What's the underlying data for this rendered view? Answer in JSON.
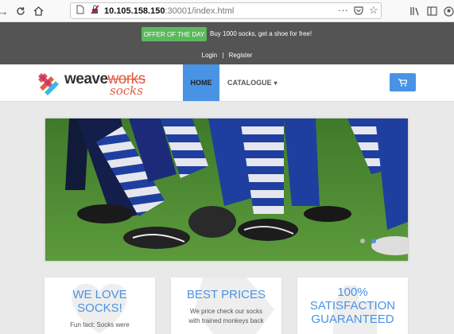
{
  "browser": {
    "url_host": "10.105.158.150",
    "url_rest": ":30001/index.html"
  },
  "topbar": {
    "offer_label": "OFFER OF THE DAY",
    "offer_text": "Buy 1000 socks, get a shoe for free!",
    "login": "Login",
    "separator": "|",
    "register": "Register"
  },
  "navbar": {
    "logo_brand": "weave",
    "logo_works": "works",
    "logo_socks": "socks",
    "home": "HOME",
    "catalogue": "CATALOGUE",
    "catalogue_caret": "▾"
  },
  "carousel": {
    "slides": 2,
    "active_slide": 2
  },
  "features": [
    {
      "title_line1": "WE LOVE",
      "title_line2": "SOCKS!",
      "body": "Fun fact: Socks were"
    },
    {
      "title_line1": "BEST PRICES",
      "body_line1": "We price check our socks",
      "body_line2": "with trained monkeys back"
    },
    {
      "title_line1": "100%",
      "title_line2": "SATISFACTION",
      "title_line3": "GUARANTEED"
    }
  ],
  "colors": {
    "accent": "#4993e4",
    "offer_green": "#5cb85c",
    "topbar": "#545454",
    "logo_orange": "#e35b3f"
  }
}
